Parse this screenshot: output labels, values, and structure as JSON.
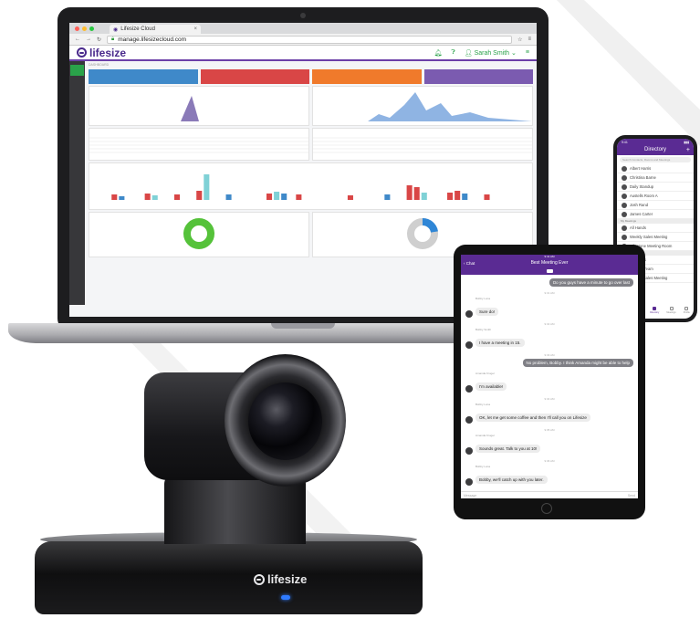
{
  "browser": {
    "tab_title": "Lifesize Cloud",
    "tab_close": "×",
    "url": "manage.lifesizecloud.com"
  },
  "app": {
    "logo_text": "lifesize",
    "user_name": "Sarah Smith",
    "breadcrumb": "DASHBOARD"
  },
  "phone": {
    "status_time": "9:41",
    "title": "Directory",
    "add": "+",
    "search_placeholder": "Search Contacts, Rooms and Meetings",
    "contacts": [
      "Albert Harris",
      "Christina Barne",
      "Daily Standup",
      "Austells Room A",
      "Josh Rand",
      "James Carter"
    ],
    "section_meetings": "My Meetings",
    "meetings": [
      "All Hands",
      "Weekly Sales Meeting",
      "Milestone Meeting Room"
    ],
    "section_rooms": "Recent Meetings",
    "recent": [
      "All Hands",
      "Product Team",
      "Weekly Sales Meeting"
    ],
    "nav": [
      "Chats",
      "Recents",
      "Directory",
      "Meetings",
      "Profile"
    ]
  },
  "tablet": {
    "status_time": "9:41 AM",
    "title": "Best Meeting Ever",
    "back": "Chat",
    "messages": [
      {
        "side": "right",
        "text": "Do you guys have a minute to go over last"
      },
      {
        "side": "left",
        "who": "Bobby Luna",
        "text": "Sure do!"
      },
      {
        "side": "left",
        "who": "Bobby Smith",
        "text": "I have a meeting in 15."
      },
      {
        "side": "right",
        "text": "No problem, Bobby. I think Amanda might be able to help"
      },
      {
        "side": "left",
        "who": "Amanda Kruger",
        "text": "I'm available!"
      },
      {
        "side": "left",
        "who": "Bobby Luna",
        "text": "OK, let me get some coffee and then I'll call you on Lifesize"
      },
      {
        "side": "left",
        "who": "Amanda Kruger",
        "text": "Sounds great. Talk to you at 10!"
      },
      {
        "side": "left",
        "who": "Bobby Luna",
        "text": "Bobby, we'll catch up with you later."
      }
    ],
    "timestamps": [
      "9:31 AM",
      "9:32 AM",
      "9:33 AM",
      "9:34 AM",
      "9:35 AM",
      "9:36 AM"
    ],
    "input_placeholder": "Message",
    "send": "Send"
  },
  "camera": {
    "logo_text": "lifesize"
  }
}
